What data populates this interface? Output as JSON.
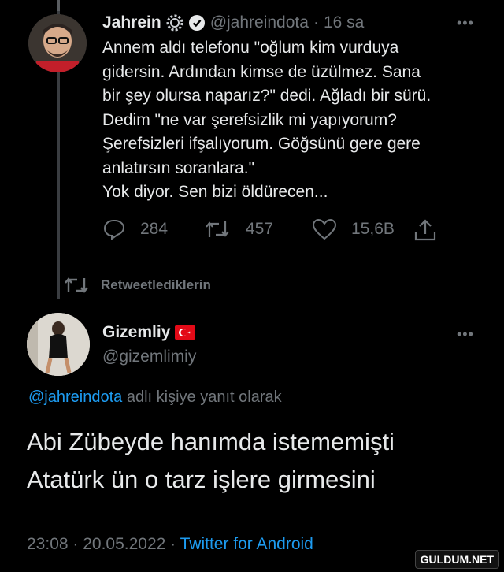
{
  "original_tweet": {
    "display_name": "Jahrein",
    "handle": "@jahreindota",
    "time_ago": "16 sa",
    "text": "Annem aldı telefonu \"oğlum kim vurduya\ngidersin. Ardından kimse de üzülmez. Sana\nbir şey olursa naparız?\" dedi. Ağladı bir sürü.\nDedim \"ne var şerefsizlik mi yapıyorum?\nŞerefsizleri ifşalıyorum. Göğsünü gere gere\nanlatırsın soranlara.\"\nYok diyor. Sen bizi öldürecen...",
    "replies": "284",
    "retweets": "457",
    "likes": "15,6B"
  },
  "retweet_context": {
    "label": "Retweetlediklerin"
  },
  "reply_tweet": {
    "display_name": "Gizemliy",
    "handle": "@gizemlimiy",
    "reply_to_handle": "@jahreindota",
    "reply_to_suffix": "adlı kişiye yanıt olarak",
    "text": "Abi Zübeyde hanımda istememişti\nAtatürk ün o tarz işlere girmesini",
    "timestamp": "23:08 · 20.05.2022 · ",
    "source": "Twitter for Android"
  },
  "more_glyph": "•••",
  "watermark": "GULDUM.NET",
  "colors": {
    "background": "#000000",
    "text": "#e7e9ea",
    "muted": "#71767b",
    "link": "#1d9bf0",
    "verified": "#e7e9ea",
    "flag_red": "#e30a17"
  }
}
